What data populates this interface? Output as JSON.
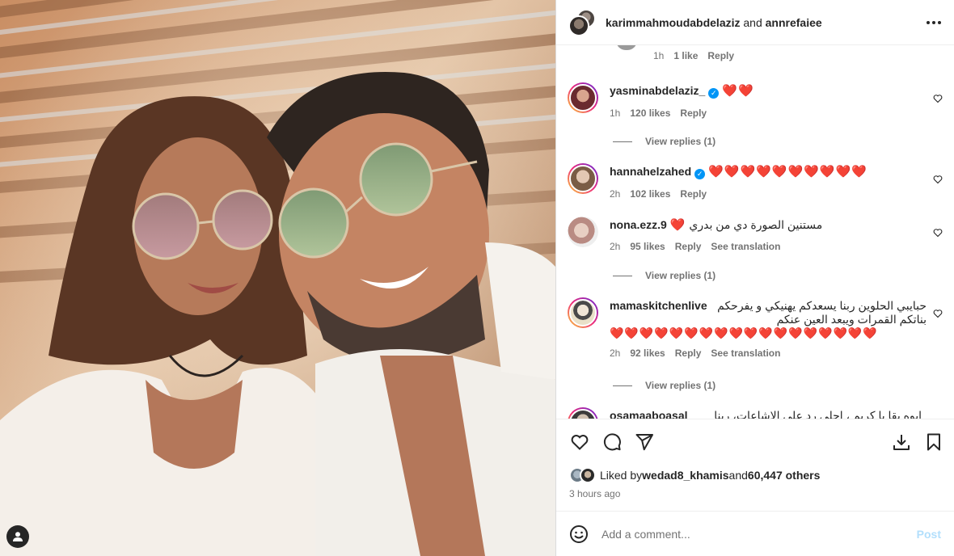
{
  "header": {
    "user1": "karimmahmoudabdelaziz",
    "joiner": " and ",
    "user2": "annrefaiee",
    "more_icon": "more-horizontal-icon"
  },
  "top_comment_meta": {
    "time": "1h",
    "likes": "1 like",
    "reply": "Reply"
  },
  "comments": [
    {
      "username": "yasminabdelaziz_",
      "verified": true,
      "text": "",
      "hearts": "❤️❤️",
      "time": "1h",
      "likes": "120 likes",
      "reply": "Reply",
      "view_replies": "View replies (1)"
    },
    {
      "username": "hannahelzahed",
      "verified": true,
      "text": "",
      "hearts": "❤️❤️❤️❤️❤️❤️❤️❤️❤️❤️",
      "time": "2h",
      "likes": "102 likes",
      "reply": "Reply"
    },
    {
      "username": "nona.ezz.9",
      "verified": false,
      "text": "مستنين الصورة دي من بدري",
      "hearts": "❤️",
      "time": "2h",
      "likes": "95 likes",
      "reply": "Reply",
      "translation": "See translation",
      "view_replies": "View replies (1)"
    },
    {
      "username": "mamaskitchenlive",
      "verified": false,
      "text": "حبايبي الحلوين ربنا يسعدكم يهنيكي و يفرحكم بناتكم القمرات ويبعد العين عنكم",
      "hearts": "❤️❤️❤️❤️❤️❤️❤️❤️❤️❤️❤️❤️❤️❤️❤️❤️❤️❤️",
      "time": "2h",
      "likes": "92 likes",
      "reply": "Reply",
      "translation": "See translation",
      "view_replies": "View replies (1)"
    },
    {
      "username": "osamaaboasal",
      "verified": false,
      "text": "ايوه بقا يا كريم ، احلى رد على الإشاعات، ربنا"
    }
  ],
  "likes_row": {
    "prefix": "Liked by ",
    "user": "wedad8_khamis",
    "joiner": " and ",
    "others": "60,447 others"
  },
  "time_ago": "3 hours ago",
  "add_comment": {
    "placeholder": "Add a comment...",
    "post_label": "Post",
    "emoji_icon": "smiley-icon"
  },
  "actions": [
    "heart-icon",
    "comment-icon",
    "share-icon",
    "save-icon"
  ],
  "colors": {
    "link_blue": "#0095f6",
    "heart_red": "#e0232f",
    "post_disabled": "#b2dffc",
    "meta_gray": "#737373"
  }
}
